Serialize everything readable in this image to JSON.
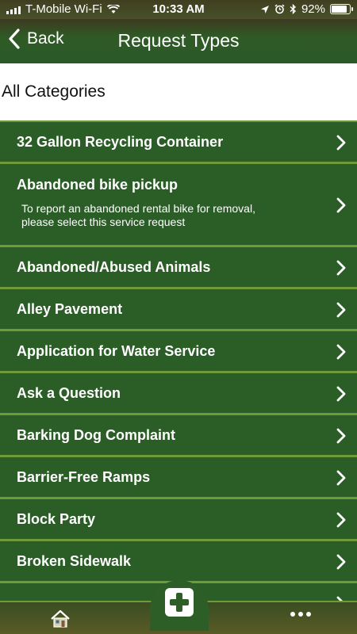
{
  "status_bar": {
    "carrier": "T-Mobile Wi-Fi",
    "time": "10:33 AM",
    "battery": "92%",
    "battery_level": 0.92,
    "icons": [
      "signal-icon",
      "wifi-icon",
      "location-arrow-icon",
      "alarm-icon",
      "bluetooth-icon",
      "battery-icon"
    ]
  },
  "nav": {
    "back_label": "Back",
    "title": "Request Types"
  },
  "category_header": "All Categories",
  "request_types": [
    {
      "title": "32 Gallon Recycling Container",
      "description": ""
    },
    {
      "title": "Abandoned bike pickup",
      "description": "To report an abandoned rental bike for removal, please select this service request"
    },
    {
      "title": "Abandoned/Abused Animals",
      "description": ""
    },
    {
      "title": "Alley Pavement",
      "description": ""
    },
    {
      "title": "Application for Water Service",
      "description": ""
    },
    {
      "title": "Ask a Question",
      "description": ""
    },
    {
      "title": "Barking Dog Complaint",
      "description": ""
    },
    {
      "title": "Barrier-Free Ramps",
      "description": ""
    },
    {
      "title": "Block Party",
      "description": ""
    },
    {
      "title": "Broken Sidewalk",
      "description": ""
    }
  ],
  "tab_bar": {
    "icons": [
      "home-icon",
      "add-icon",
      "more-icon"
    ]
  },
  "colors": {
    "row_background": "#2b5d27",
    "row_border": "#6f9a3b",
    "header_background": "#ffffff",
    "text": "#ffffff"
  }
}
